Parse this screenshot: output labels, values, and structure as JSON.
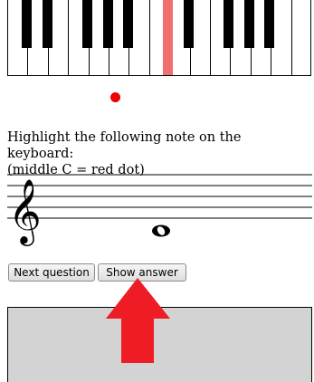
{
  "keyboard": {
    "white_key_count": 15,
    "black_keys": [
      "C#",
      "D#",
      "F#",
      "G#",
      "A#",
      "C#",
      "D#",
      "F#",
      "G#",
      "A#"
    ],
    "highlighted_black_key": "F#",
    "highlight_color": "#f07070",
    "middle_c_marker_color": "#ee0000"
  },
  "instruction": {
    "line1": "Highlight the following note on the keyboard:",
    "line2": "(middle C = red dot)"
  },
  "staff": {
    "clef": "treble",
    "clef_glyph": "𝄞",
    "note": "whole note below staff"
  },
  "buttons": {
    "next_question": "Next question",
    "show_answer": "Show answer"
  },
  "arrow": {
    "color": "#ee1c24",
    "direction": "up",
    "points_to": "show-answer-button"
  },
  "answer_box": {
    "background": "#d3d3d3"
  }
}
